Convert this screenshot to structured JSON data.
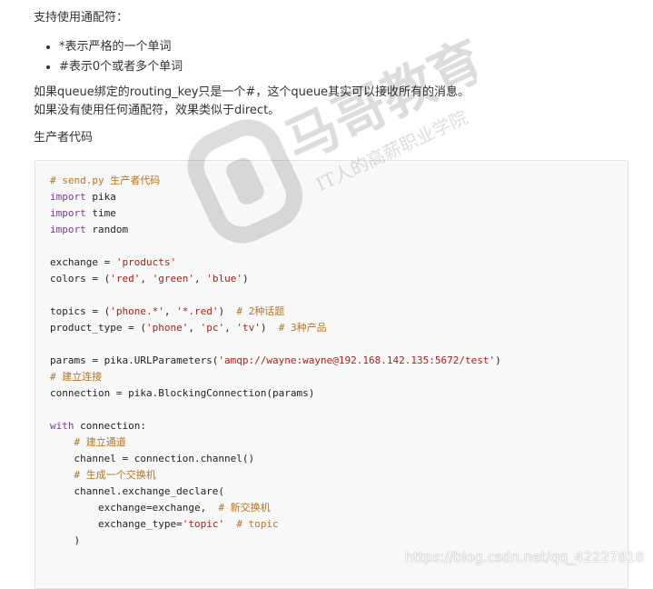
{
  "intro": "支持使用通配符：",
  "bullets": [
    "*表示严格的一个单词",
    "#表示0个或者多个单词"
  ],
  "para1": "如果queue绑定的routing_key只是一个#，这个queue其实可以接收所有的消息。",
  "para2": "如果没有使用任何通配符，效果类似于direct。",
  "heading": "生产者代码",
  "colors": {
    "comment": "#b8731f",
    "keyword": "#7a3a9a",
    "string": "#a8201a",
    "code_bg": "#f8f8f8"
  },
  "code_lines": [
    [
      [
        "cm",
        "# send.py 生产者代码"
      ]
    ],
    [
      [
        "kw",
        "import"
      ],
      [
        "tx",
        " pika"
      ]
    ],
    [
      [
        "kw",
        "import"
      ],
      [
        "tx",
        " time"
      ]
    ],
    [
      [
        "kw",
        "import"
      ],
      [
        "tx",
        " random"
      ]
    ],
    [],
    [
      [
        "tx",
        "exchange = "
      ],
      [
        "st",
        "'products'"
      ]
    ],
    [
      [
        "tx",
        "colors = ("
      ],
      [
        "st",
        "'red'"
      ],
      [
        "tx",
        ", "
      ],
      [
        "st",
        "'green'"
      ],
      [
        "tx",
        ", "
      ],
      [
        "st",
        "'blue'"
      ],
      [
        "tx",
        ")"
      ]
    ],
    [],
    [
      [
        "tx",
        "topics = ("
      ],
      [
        "st",
        "'phone.*'"
      ],
      [
        "tx",
        ", "
      ],
      [
        "st",
        "'*.red'"
      ],
      [
        "tx",
        ")  "
      ],
      [
        "cm",
        "# 2种话题"
      ]
    ],
    [
      [
        "tx",
        "product_type = ("
      ],
      [
        "st",
        "'phone'"
      ],
      [
        "tx",
        ", "
      ],
      [
        "st",
        "'pc'"
      ],
      [
        "tx",
        ", "
      ],
      [
        "st",
        "'tv'"
      ],
      [
        "tx",
        ")  "
      ],
      [
        "cm",
        "# 3种产品"
      ]
    ],
    [],
    [
      [
        "tx",
        "params = pika.URLParameters("
      ],
      [
        "st",
        "'amqp://wayne:wayne@192.168.142.135:5672/test'"
      ],
      [
        "tx",
        ")"
      ]
    ],
    [
      [
        "cm",
        "# 建立连接"
      ]
    ],
    [
      [
        "tx",
        "connection = pika.BlockingConnection(params)"
      ]
    ],
    [],
    [
      [
        "kw",
        "with"
      ],
      [
        "tx",
        " connection:"
      ]
    ],
    [
      [
        "tx",
        "    "
      ],
      [
        "cm",
        "# 建立通道"
      ]
    ],
    [
      [
        "tx",
        "    channel = connection.channel()"
      ]
    ],
    [
      [
        "tx",
        "    "
      ],
      [
        "cm",
        "# 生成一个交换机"
      ]
    ],
    [
      [
        "tx",
        "    channel.exchange_declare("
      ]
    ],
    [
      [
        "tx",
        "        exchange=exchange,  "
      ],
      [
        "cm",
        "# 新交换机"
      ]
    ],
    [
      [
        "tx",
        "        exchange_type="
      ],
      [
        "st",
        "'topic'"
      ],
      [
        "tx",
        "  "
      ],
      [
        "cm",
        "# topic"
      ]
    ],
    [
      [
        "tx",
        "    )"
      ]
    ]
  ],
  "watermark": {
    "brand": "马哥教育",
    "slogan": "IT人的高薪职业学院"
  },
  "source_url": "https://blog.csdn.net/qq_42227818"
}
